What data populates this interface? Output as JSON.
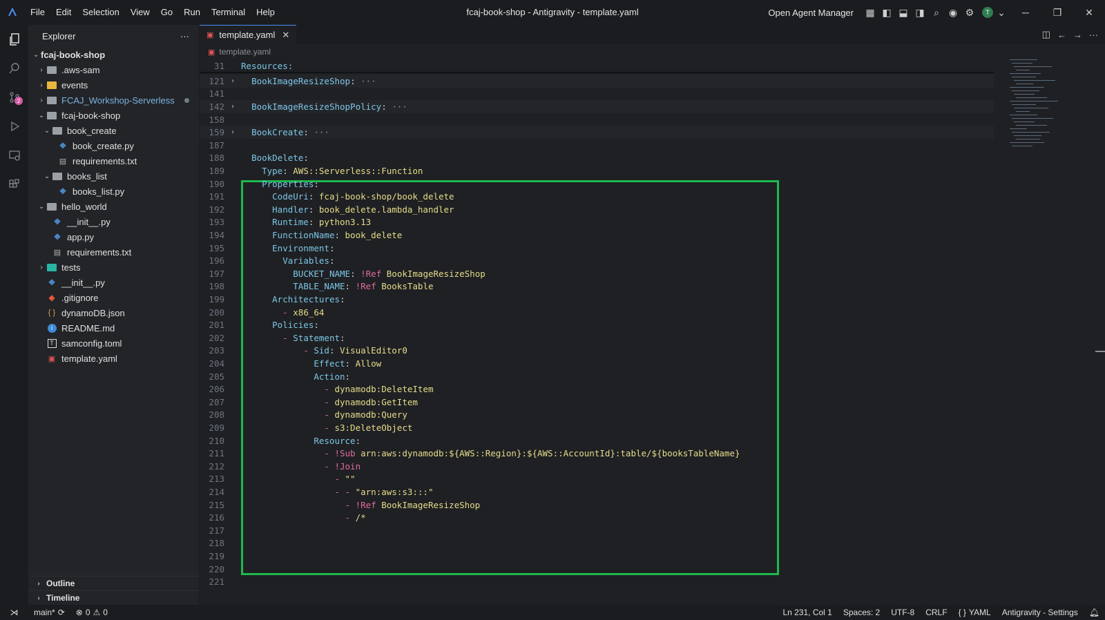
{
  "titlebar": {
    "menu": [
      "File",
      "Edit",
      "Selection",
      "View",
      "Go",
      "Run",
      "Terminal",
      "Help"
    ],
    "window_title": "fcaj-book-shop - Antigravity - template.yaml",
    "agent_manager": "Open Agent Manager",
    "avatar_initial": "T"
  },
  "activitybar": {
    "scm_badge": "2"
  },
  "explorer": {
    "title": "Explorer",
    "more": "···",
    "root": "fcaj-book-shop",
    "items": [
      {
        "label": ".aws-sam",
        "level": 1,
        "kind": "folder",
        "expanded": false
      },
      {
        "label": "events",
        "level": 1,
        "kind": "folder-yellow",
        "expanded": false
      },
      {
        "label": "FCAJ_Workshop-Serverless",
        "level": 1,
        "kind": "folder",
        "expanded": false,
        "modified": true
      },
      {
        "label": "fcaj-book-shop",
        "level": 1,
        "kind": "folder-open",
        "expanded": true
      },
      {
        "label": "book_create",
        "level": 2,
        "kind": "folder-open",
        "expanded": true
      },
      {
        "label": "book_create.py",
        "level": 3,
        "kind": "py"
      },
      {
        "label": "requirements.txt",
        "level": 3,
        "kind": "txt"
      },
      {
        "label": "books_list",
        "level": 2,
        "kind": "folder-open",
        "expanded": true
      },
      {
        "label": "books_list.py",
        "level": 3,
        "kind": "py"
      },
      {
        "label": "hello_world",
        "level": 1,
        "kind": "folder-open",
        "expanded": true
      },
      {
        "label": "__init__.py",
        "level": 2,
        "kind": "py"
      },
      {
        "label": "app.py",
        "level": 2,
        "kind": "py"
      },
      {
        "label": "requirements.txt",
        "level": 2,
        "kind": "txt"
      },
      {
        "label": "tests",
        "level": 1,
        "kind": "folder-teal",
        "expanded": false
      },
      {
        "label": "__init__.py",
        "level": 1,
        "kind": "py"
      },
      {
        "label": ".gitignore",
        "level": 1,
        "kind": "git"
      },
      {
        "label": "dynamoDB.json",
        "level": 1,
        "kind": "json"
      },
      {
        "label": "README.md",
        "level": 1,
        "kind": "info"
      },
      {
        "label": "samconfig.toml",
        "level": 1,
        "kind": "toml"
      },
      {
        "label": "template.yaml",
        "level": 1,
        "kind": "yaml"
      }
    ],
    "outline": "Outline",
    "timeline": "Timeline"
  },
  "editor": {
    "tab_label": "template.yaml",
    "tab_close": "✕",
    "breadcrumb": "template.yaml",
    "sticky": {
      "ln": "31",
      "text": "Resources:"
    },
    "lines": [
      {
        "ln": "121",
        "fold": "›",
        "parts": [
          [
            "p",
            "  "
          ],
          [
            "k",
            "BookImageResizeShop"
          ],
          [
            "p",
            ":"
          ],
          [
            "dots",
            " ···"
          ]
        ],
        "shaded": true
      },
      {
        "ln": "141",
        "parts": []
      },
      {
        "ln": "142",
        "fold": "›",
        "parts": [
          [
            "p",
            "  "
          ],
          [
            "k",
            "BookImageResizeShopPolicy"
          ],
          [
            "p",
            ":"
          ],
          [
            "dots",
            " ···"
          ]
        ],
        "shaded": true
      },
      {
        "ln": "158",
        "parts": []
      },
      {
        "ln": "159",
        "fold": "›",
        "parts": [
          [
            "p",
            "  "
          ],
          [
            "k",
            "BookCreate"
          ],
          [
            "p",
            ":"
          ],
          [
            "dots",
            " ···"
          ]
        ],
        "shaded": true
      },
      {
        "ln": "187",
        "parts": []
      },
      {
        "ln": "188",
        "parts": [
          [
            "p",
            "  "
          ],
          [
            "k",
            "BookDelete"
          ],
          [
            "p",
            ":"
          ]
        ]
      },
      {
        "ln": "189",
        "parts": [
          [
            "p",
            "    "
          ],
          [
            "k",
            "Type"
          ],
          [
            "p",
            ": "
          ],
          [
            "v",
            "AWS::Serverless::Function"
          ]
        ]
      },
      {
        "ln": "190",
        "parts": [
          [
            "p",
            "    "
          ],
          [
            "k",
            "Properties"
          ],
          [
            "p",
            ":"
          ]
        ]
      },
      {
        "ln": "191",
        "parts": [
          [
            "p",
            "      "
          ],
          [
            "k",
            "CodeUri"
          ],
          [
            "p",
            ": "
          ],
          [
            "v",
            "fcaj-book-shop/book_delete"
          ]
        ]
      },
      {
        "ln": "192",
        "parts": [
          [
            "p",
            "      "
          ],
          [
            "k",
            "Handler"
          ],
          [
            "p",
            ": "
          ],
          [
            "v",
            "book_delete.lambda_handler"
          ]
        ]
      },
      {
        "ln": "193",
        "parts": [
          [
            "p",
            "      "
          ],
          [
            "k",
            "Runtime"
          ],
          [
            "p",
            ": "
          ],
          [
            "v",
            "python3.13"
          ]
        ]
      },
      {
        "ln": "194",
        "parts": [
          [
            "p",
            "      "
          ],
          [
            "k",
            "FunctionName"
          ],
          [
            "p",
            ": "
          ],
          [
            "v",
            "book_delete"
          ]
        ]
      },
      {
        "ln": "195",
        "parts": [
          [
            "p",
            "      "
          ],
          [
            "k",
            "Environment"
          ],
          [
            "p",
            ":"
          ]
        ]
      },
      {
        "ln": "196",
        "parts": [
          [
            "p",
            "        "
          ],
          [
            "k",
            "Variables"
          ],
          [
            "p",
            ":"
          ]
        ]
      },
      {
        "ln": "197",
        "parts": [
          [
            "p",
            "          "
          ],
          [
            "k",
            "BUCKET_NAME"
          ],
          [
            "p",
            ": "
          ],
          [
            "tag",
            "!Ref"
          ],
          [
            "p",
            " "
          ],
          [
            "v",
            "BookImageResizeShop"
          ]
        ]
      },
      {
        "ln": "198",
        "parts": [
          [
            "p",
            "          "
          ],
          [
            "k",
            "TABLE_NAME"
          ],
          [
            "p",
            ": "
          ],
          [
            "tag",
            "!Ref"
          ],
          [
            "p",
            " "
          ],
          [
            "v",
            "BooksTable"
          ]
        ]
      },
      {
        "ln": "199",
        "parts": [
          [
            "p",
            "      "
          ],
          [
            "k",
            "Architectures"
          ],
          [
            "p",
            ":"
          ]
        ]
      },
      {
        "ln": "200",
        "parts": [
          [
            "p",
            "        "
          ],
          [
            "dash",
            "-"
          ],
          [
            "p",
            " "
          ],
          [
            "v",
            "x86_64"
          ]
        ]
      },
      {
        "ln": "201",
        "parts": [
          [
            "p",
            "      "
          ],
          [
            "k",
            "Policies"
          ],
          [
            "p",
            ":"
          ]
        ]
      },
      {
        "ln": "202",
        "parts": [
          [
            "p",
            "        "
          ],
          [
            "dash",
            "-"
          ],
          [
            "p",
            " "
          ],
          [
            "k",
            "Statement"
          ],
          [
            "p",
            ":"
          ]
        ]
      },
      {
        "ln": "203",
        "parts": [
          [
            "p",
            "            "
          ],
          [
            "dash",
            "-"
          ],
          [
            "p",
            " "
          ],
          [
            "k",
            "Sid"
          ],
          [
            "p",
            ": "
          ],
          [
            "v",
            "VisualEditor0"
          ]
        ]
      },
      {
        "ln": "204",
        "parts": [
          [
            "p",
            "              "
          ],
          [
            "k",
            "Effect"
          ],
          [
            "p",
            ": "
          ],
          [
            "v",
            "Allow"
          ]
        ]
      },
      {
        "ln": "205",
        "parts": [
          [
            "p",
            "              "
          ],
          [
            "k",
            "Action"
          ],
          [
            "p",
            ":"
          ]
        ]
      },
      {
        "ln": "206",
        "parts": [
          [
            "p",
            "                "
          ],
          [
            "dash",
            "-"
          ],
          [
            "p",
            " "
          ],
          [
            "v",
            "dynamodb:DeleteItem"
          ]
        ]
      },
      {
        "ln": "207",
        "parts": [
          [
            "p",
            "                "
          ],
          [
            "dash",
            "-"
          ],
          [
            "p",
            " "
          ],
          [
            "v",
            "dynamodb:GetItem"
          ]
        ]
      },
      {
        "ln": "208",
        "parts": [
          [
            "p",
            "                "
          ],
          [
            "dash",
            "-"
          ],
          [
            "p",
            " "
          ],
          [
            "v",
            "dynamodb:Query"
          ]
        ]
      },
      {
        "ln": "209",
        "parts": [
          [
            "p",
            "                "
          ],
          [
            "dash",
            "-"
          ],
          [
            "p",
            " "
          ],
          [
            "v",
            "s3:DeleteObject"
          ]
        ]
      },
      {
        "ln": "210",
        "parts": [
          [
            "p",
            "              "
          ],
          [
            "k",
            "Resource"
          ],
          [
            "p",
            ":"
          ]
        ]
      },
      {
        "ln": "211",
        "parts": [
          [
            "p",
            "                "
          ],
          [
            "dash",
            "-"
          ],
          [
            "p",
            " "
          ],
          [
            "tag",
            "!Sub"
          ],
          [
            "p",
            " "
          ],
          [
            "v",
            "arn:aws:dynamodb:${AWS::Region}:${AWS::AccountId}:table/${booksTableName}"
          ]
        ]
      },
      {
        "ln": "212",
        "parts": [
          [
            "p",
            "                "
          ],
          [
            "dash",
            "-"
          ],
          [
            "p",
            " "
          ],
          [
            "tag",
            "!Join"
          ]
        ]
      },
      {
        "ln": "213",
        "parts": [
          [
            "p",
            "                  "
          ],
          [
            "dash",
            "-"
          ],
          [
            "p",
            " "
          ],
          [
            "v",
            "\"\""
          ]
        ]
      },
      {
        "ln": "214",
        "parts": [
          [
            "p",
            "                  "
          ],
          [
            "dash",
            "-"
          ],
          [
            "p",
            " "
          ],
          [
            "dash",
            "-"
          ],
          [
            "p",
            " "
          ],
          [
            "v",
            "\"arn:aws:s3:::\""
          ]
        ]
      },
      {
        "ln": "215",
        "parts": [
          [
            "p",
            "                    "
          ],
          [
            "dash",
            "-"
          ],
          [
            "p",
            " "
          ],
          [
            "tag",
            "!Ref"
          ],
          [
            "p",
            " "
          ],
          [
            "v",
            "BookImageResizeShop"
          ]
        ]
      },
      {
        "ln": "216",
        "parts": [
          [
            "p",
            "                    "
          ],
          [
            "dash",
            "-"
          ],
          [
            "p",
            " "
          ],
          [
            "v",
            "/*"
          ]
        ]
      },
      {
        "ln": "217",
        "parts": []
      },
      {
        "ln": "218",
        "parts": []
      },
      {
        "ln": "219",
        "parts": []
      },
      {
        "ln": "220",
        "parts": []
      },
      {
        "ln": "221",
        "parts": []
      }
    ]
  },
  "statusbar": {
    "branch": "main*",
    "errors": "0",
    "warnings": "0",
    "position": "Ln 231, Col 1",
    "spaces": "Spaces: 2",
    "encoding": "UTF-8",
    "eol": "CRLF",
    "language": "YAML",
    "settings": "Antigravity - Settings"
  },
  "colors": {
    "highlight_border": "#1fb84f",
    "accent": "#4b8df8"
  }
}
